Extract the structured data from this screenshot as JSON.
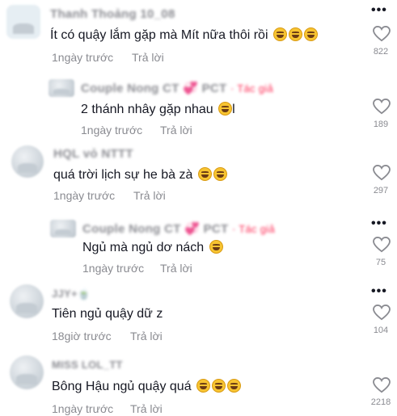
{
  "comments": [
    {
      "username": "Thanh Thoảng 10_08",
      "text": "Ít có quậy lắm gặp mà Mít nữa thôi rồi",
      "emojis": [
        "rofl-emoji",
        "rofl-emoji",
        "rofl-emoji"
      ],
      "time": "1ngày trước",
      "reply_label": "Trả lời",
      "likes": "822"
    },
    {
      "username": "Couple Nong CT 💞 PCT",
      "author_tag": "· Tác giả",
      "text": "2 thánh nhây gặp nhau",
      "text_suffix": "l",
      "emojis": [
        "grinning-sweat-emoji"
      ],
      "time": "1ngày trước",
      "reply_label": "Trả lời",
      "likes": "189"
    },
    {
      "username": "HQL vỏ NTTT",
      "text": "quá trời lịch sự he bà zà",
      "emojis": [
        "grinning-sweat-emoji",
        "grinning-sweat-emoji"
      ],
      "time": "1ngày trước",
      "reply_label": "Trả lời",
      "likes": "297"
    },
    {
      "username": "Couple Nong CT 💞 PCT",
      "author_tag": "· Tác giả",
      "text": "Ngủ mà ngủ dơ nách",
      "emojis": [
        "grinning-sweat-emoji"
      ],
      "time": "1ngày trước",
      "reply_label": "Trả lời",
      "likes": "75"
    },
    {
      "username": "JJY+🍵",
      "text": "Tiên ngủ quậy dữ z",
      "emojis": [],
      "time": "18giờ trước",
      "reply_label": "Trả lời",
      "likes": "104"
    },
    {
      "username": "MISS LOL_TT",
      "text": "Bông Hậu ngủ quậy quá",
      "emojis": [
        "grinning-sweat-emoji",
        "grinning-sweat-emoji",
        "grinning-sweat-emoji"
      ],
      "time": "1ngày trước",
      "reply_label": "Trả lời",
      "likes": "2218"
    }
  ],
  "icons": {
    "more": "more-dots-icon",
    "like": "heart-outline-icon"
  },
  "colors": {
    "text": "#161823",
    "meta": "#8a8b91",
    "author_tag": "#fe2c55"
  }
}
